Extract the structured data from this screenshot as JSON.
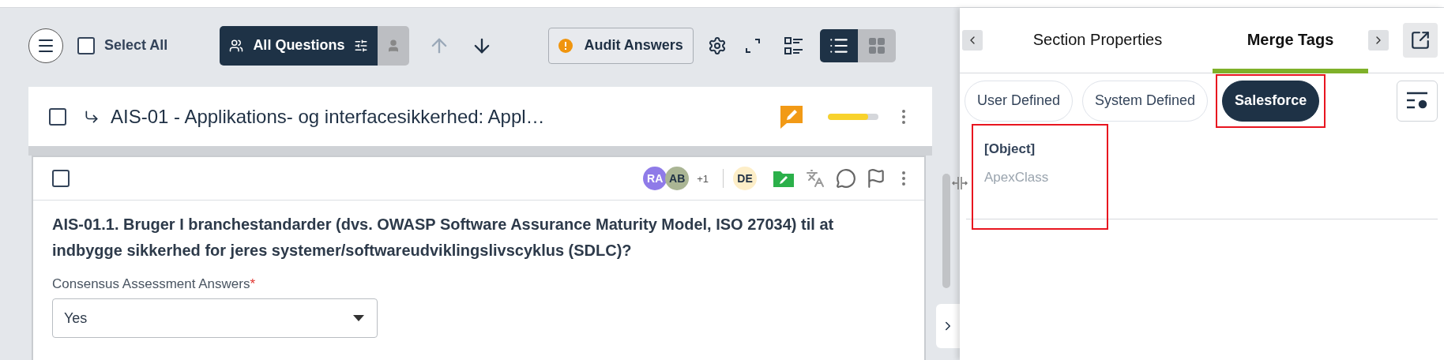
{
  "toolbar": {
    "select_all": {
      "label": "Select All",
      "checked": false
    },
    "filter": {
      "label": "All Questions"
    },
    "audit_button": {
      "label": "Audit Answers"
    },
    "view_modes": [
      {
        "kind": "list",
        "selected": true
      },
      {
        "kind": "grid",
        "selected": false
      }
    ]
  },
  "section": {
    "title": "AIS-01 - Applikations- og interfacesikkerhed: Appl…",
    "checked": false,
    "level": 0.8
  },
  "question": {
    "checked": false,
    "assignees": [
      {
        "initials": "RA",
        "color": "#8f7be8"
      },
      {
        "initials": "AB",
        "color": "#aab594"
      }
    ],
    "more_count": "+1",
    "reviewer": {
      "initials": "DE",
      "color": "#fdeec8"
    },
    "text": "AIS-01.1. Bruger I branchestandarder (dvs. OWASP Software Assurance Maturity Model, ISO 27034) til at indbygge sikkerhed for jeres systemer/softwareudviklingslivscyklus (SDLC)?",
    "field_label": "Consensus Assessment Answers",
    "required_mark": "*",
    "value": "Yes"
  },
  "panel": {
    "tabs": [
      {
        "label": "Section Properties",
        "selected": false
      },
      {
        "label": "Merge Tags",
        "selected": true
      }
    ],
    "filters": [
      {
        "label": "User Defined",
        "selected": false,
        "highlighted": false
      },
      {
        "label": "System Defined",
        "selected": false,
        "highlighted": false
      },
      {
        "label": "Salesforce",
        "selected": true,
        "highlighted": true
      }
    ],
    "tag_groups": [
      {
        "name": "[Object]",
        "tags": [
          "ApexClass"
        ],
        "highlighted": true
      }
    ]
  }
}
